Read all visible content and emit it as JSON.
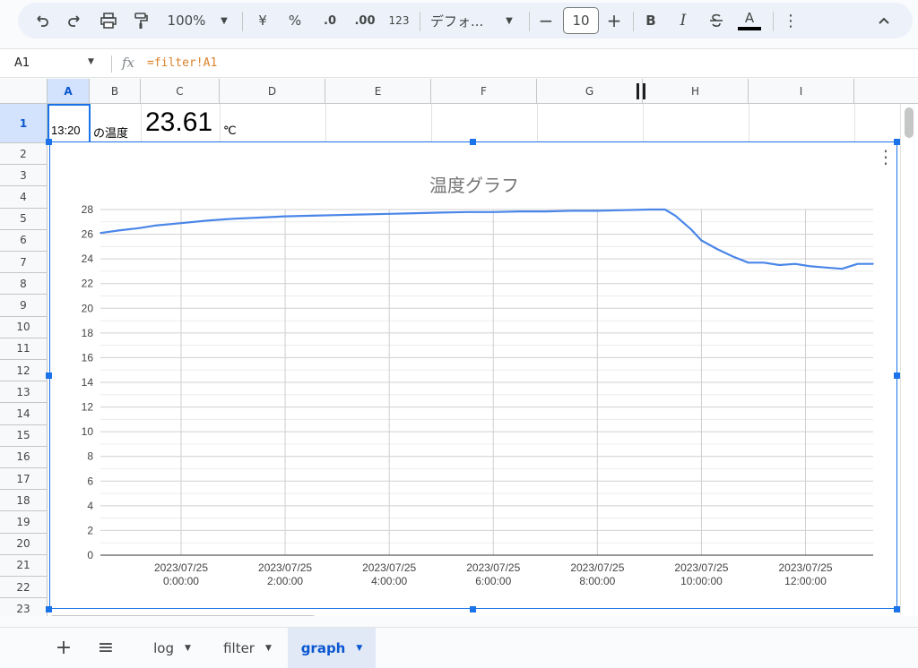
{
  "toolbar": {
    "zoom": "100%",
    "currency": "¥",
    "percent": "%",
    "dec_decrease": ".0",
    "dec_increase": ".00",
    "number_format": "123",
    "font": "デフォ...",
    "font_size": "10",
    "bold": "B",
    "italic": "I",
    "text_color": "A"
  },
  "formula_bar": {
    "cell_ref": "A1",
    "fx": "fx",
    "formula": "=filter!A1"
  },
  "columns": [
    "A",
    "B",
    "C",
    "D",
    "E",
    "F",
    "G",
    "H",
    "I"
  ],
  "rows": [
    "1",
    "2",
    "3",
    "4",
    "5",
    "6",
    "7",
    "8",
    "9",
    "10",
    "11",
    "12",
    "13",
    "14",
    "15",
    "16",
    "17",
    "18",
    "19",
    "20",
    "21",
    "22",
    "23"
  ],
  "cells": {
    "a1": "13:20",
    "b1": "の温度",
    "c1": "23.61",
    "d1": "℃"
  },
  "chart_data": {
    "type": "line",
    "title": "温度グラフ",
    "xlabel": "",
    "ylabel": "",
    "ylim": [
      0,
      28
    ],
    "y_ticks": [
      0,
      2,
      4,
      6,
      8,
      10,
      12,
      14,
      16,
      18,
      20,
      22,
      24,
      26,
      28
    ],
    "x_tick_labels": [
      [
        "2023/07/25",
        "0:00:00"
      ],
      [
        "2023/07/25",
        "2:00:00"
      ],
      [
        "2023/07/25",
        "4:00:00"
      ],
      [
        "2023/07/25",
        "6:00:00"
      ],
      [
        "2023/07/25",
        "8:00:00"
      ],
      [
        "2023/07/25",
        "10:00:00"
      ],
      [
        "2023/07/25",
        "12:00:00"
      ]
    ],
    "x_ticks_hours": [
      0,
      2,
      4,
      6,
      8,
      10,
      12
    ],
    "xlim_hours": [
      -1.55,
      13.3
    ],
    "grid": true,
    "series": [
      {
        "color": "#4a86e8",
        "x": [
          -1.55,
          -1.2,
          -0.8,
          -0.5,
          0,
          0.5,
          1,
          1.5,
          2,
          2.5,
          3,
          3.5,
          4,
          4.5,
          5,
          5.5,
          6,
          6.5,
          7,
          7.5,
          8,
          8.5,
          9,
          9.3,
          9.5,
          9.8,
          10,
          10.3,
          10.6,
          10.9,
          11.2,
          11.5,
          11.8,
          12.1,
          12.4,
          12.7,
          13.0,
          13.3
        ],
        "y": [
          26.1,
          26.3,
          26.5,
          26.7,
          26.9,
          27.1,
          27.25,
          27.35,
          27.45,
          27.5,
          27.55,
          27.6,
          27.65,
          27.7,
          27.75,
          27.8,
          27.8,
          27.85,
          27.85,
          27.9,
          27.9,
          27.95,
          28.0,
          28.0,
          27.5,
          26.4,
          25.5,
          24.8,
          24.2,
          23.7,
          23.7,
          23.5,
          23.6,
          23.4,
          23.3,
          23.2,
          23.6,
          23.6
        ]
      }
    ]
  },
  "sheet_tabs": {
    "add": "+",
    "list": "≡",
    "tabs": [
      "log",
      "filter",
      "graph"
    ],
    "active": "graph"
  }
}
